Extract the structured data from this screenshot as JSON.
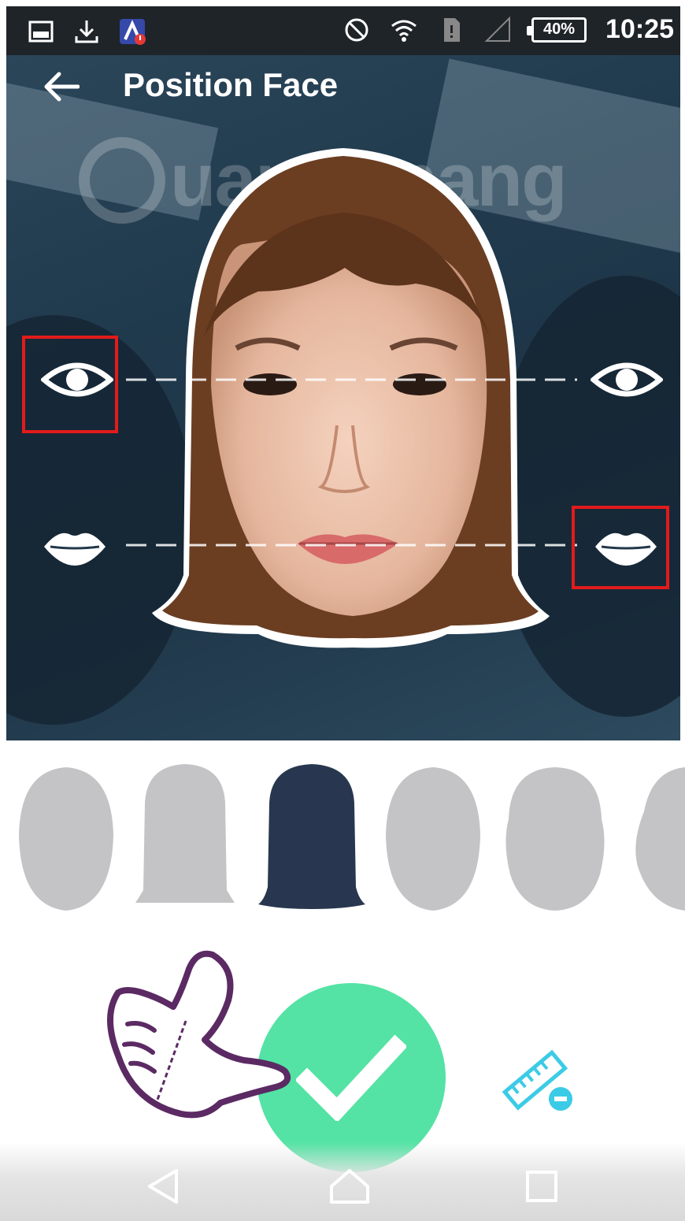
{
  "status_bar": {
    "time": "10:25",
    "battery": "40%",
    "left_icons": [
      "image-icon",
      "download-icon",
      "app-alert-icon"
    ],
    "right_icons": [
      "block-icon",
      "wifi-icon",
      "sim-icon",
      "signal-icon",
      "battery-icon"
    ]
  },
  "app_bar": {
    "title": "Position Face",
    "back_icon": "arrow-left-icon"
  },
  "watermark": {
    "text": "uantrimang"
  },
  "guides": {
    "eye_icon": "eye-icon",
    "lips_icon": "lips-icon"
  },
  "face_templates": {
    "items": [
      "template-oval",
      "template-bob",
      "template-long-hair",
      "template-egg",
      "template-wide",
      "template-partial"
    ],
    "selected": 2,
    "color_inactive": "#c4c4c6",
    "color_selected": "#28374f"
  },
  "actions": {
    "confirm_icon": "check-icon",
    "ruler_icon": "ruler-minus-icon"
  },
  "nav": {
    "icons": [
      "back-triangle-icon",
      "home-icon",
      "recents-square-icon"
    ]
  },
  "colors": {
    "accent_green": "#54e3a4",
    "ruler_cyan": "#3ccbe6",
    "highlight_red": "#e21b1b",
    "photo_bg": "#1f3a4e",
    "hand_outline": "#5b2a63"
  }
}
